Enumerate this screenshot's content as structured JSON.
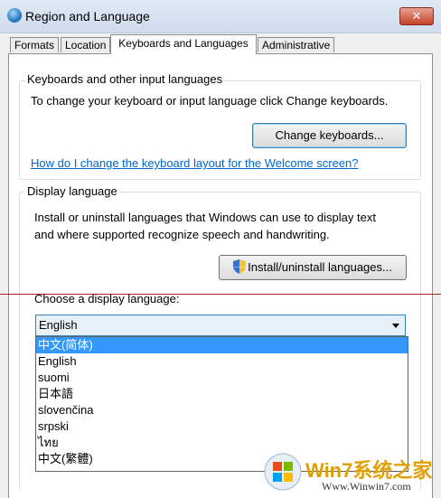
{
  "window": {
    "title": "Region and Language",
    "close_glyph": "✕"
  },
  "tabs": [
    {
      "label": "Formats"
    },
    {
      "label": "Location"
    },
    {
      "label": "Keyboards and Languages"
    },
    {
      "label": "Administrative"
    }
  ],
  "keyboards_group": {
    "label": "Keyboards and other input languages",
    "description": "To change your keyboard or input language click Change keyboards.",
    "button_label": "Change keyboards...",
    "help_link": "How do I change the keyboard layout for the Welcome screen?"
  },
  "display_group": {
    "label": "Display language",
    "description_line1": "Install or uninstall languages that Windows can use to display text",
    "description_line2": "and where supported recognize speech and handwriting.",
    "button_label": "Install/uninstall languages...",
    "choose_label": "Choose a display language:",
    "selected_value": "English",
    "options": [
      "中文(简体)",
      "English",
      "suomi",
      "日本語",
      "slovenčina",
      "srpski",
      "ไทย",
      "中文(繁體)"
    ],
    "highlighted_index": 0
  },
  "watermark": {
    "brand": "Win7系统之家",
    "url": "Www.Winwin7.com"
  },
  "icons": {
    "app": "globe-icon",
    "close": "close-icon",
    "shield": "uac-shield-icon",
    "dropdown": "chevron-down-icon"
  }
}
